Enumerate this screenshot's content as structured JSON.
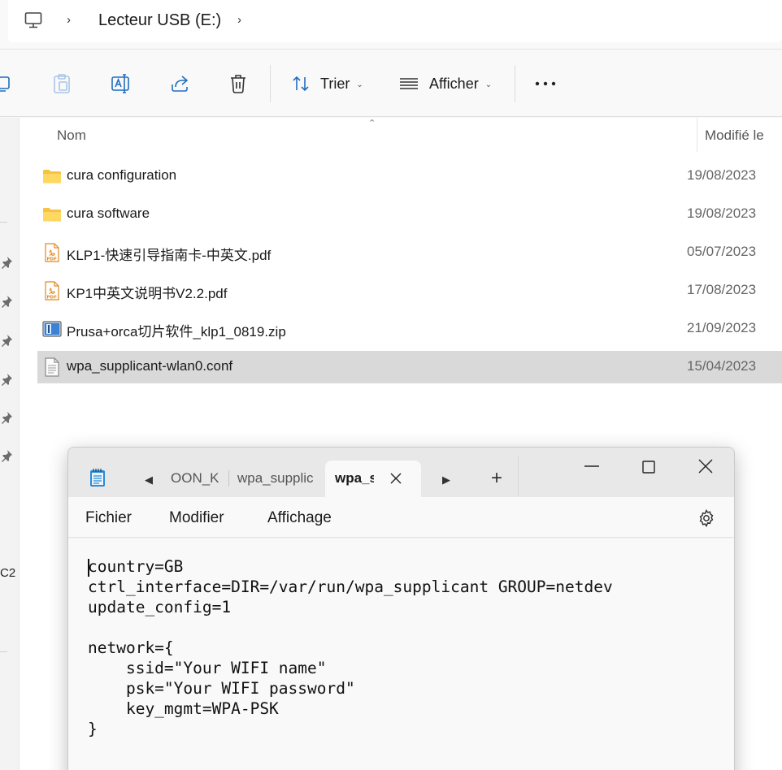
{
  "address": {
    "segments": [
      "Lecteur USB (E:)"
    ]
  },
  "toolbar": {
    "sort_label": "Trier",
    "view_label": "Afficher"
  },
  "file_list": {
    "columns": {
      "name": "Nom",
      "modified": "Modifié le"
    },
    "rows": [
      {
        "name": "cura configuration",
        "modified": "19/08/2023",
        "icon": "folder-icon",
        "selected": false
      },
      {
        "name": "cura software",
        "modified": "19/08/2023",
        "icon": "folder-icon",
        "selected": false
      },
      {
        "name": "KLP1-快速引导指南卡-中英文.pdf",
        "modified": "05/07/2023",
        "icon": "pdf-file-icon",
        "selected": false
      },
      {
        "name": "KP1中英文说明书V2.2.pdf",
        "modified": "17/08/2023",
        "icon": "pdf-file-icon",
        "selected": false
      },
      {
        "name": "Prusa+orca切片软件_klp1_0819.zip",
        "modified": "21/09/2023",
        "icon": "zip-archive-icon",
        "selected": false
      },
      {
        "name": "wpa_supplicant-wlan0.conf",
        "modified": "15/04/2023",
        "icon": "text-file-icon",
        "selected": true
      }
    ]
  },
  "nav_pane": {
    "fragment": "C2"
  },
  "notepad": {
    "tabs": [
      {
        "label": "OON_K",
        "active": false
      },
      {
        "label": "wpa_supplic",
        "active": false
      },
      {
        "label": "wpa_s",
        "active": true
      }
    ],
    "menu": [
      "Fichier",
      "Modifier",
      "Affichage"
    ],
    "content": "country=GB\nctrl_interface=DIR=/var/run/wpa_supplicant GROUP=netdev\nupdate_config=1\n\nnetwork={\n    ssid=\"Your WIFI name\"\n    psk=\"Your WIFI password\"\n    key_mgmt=WPA-PSK\n}"
  }
}
